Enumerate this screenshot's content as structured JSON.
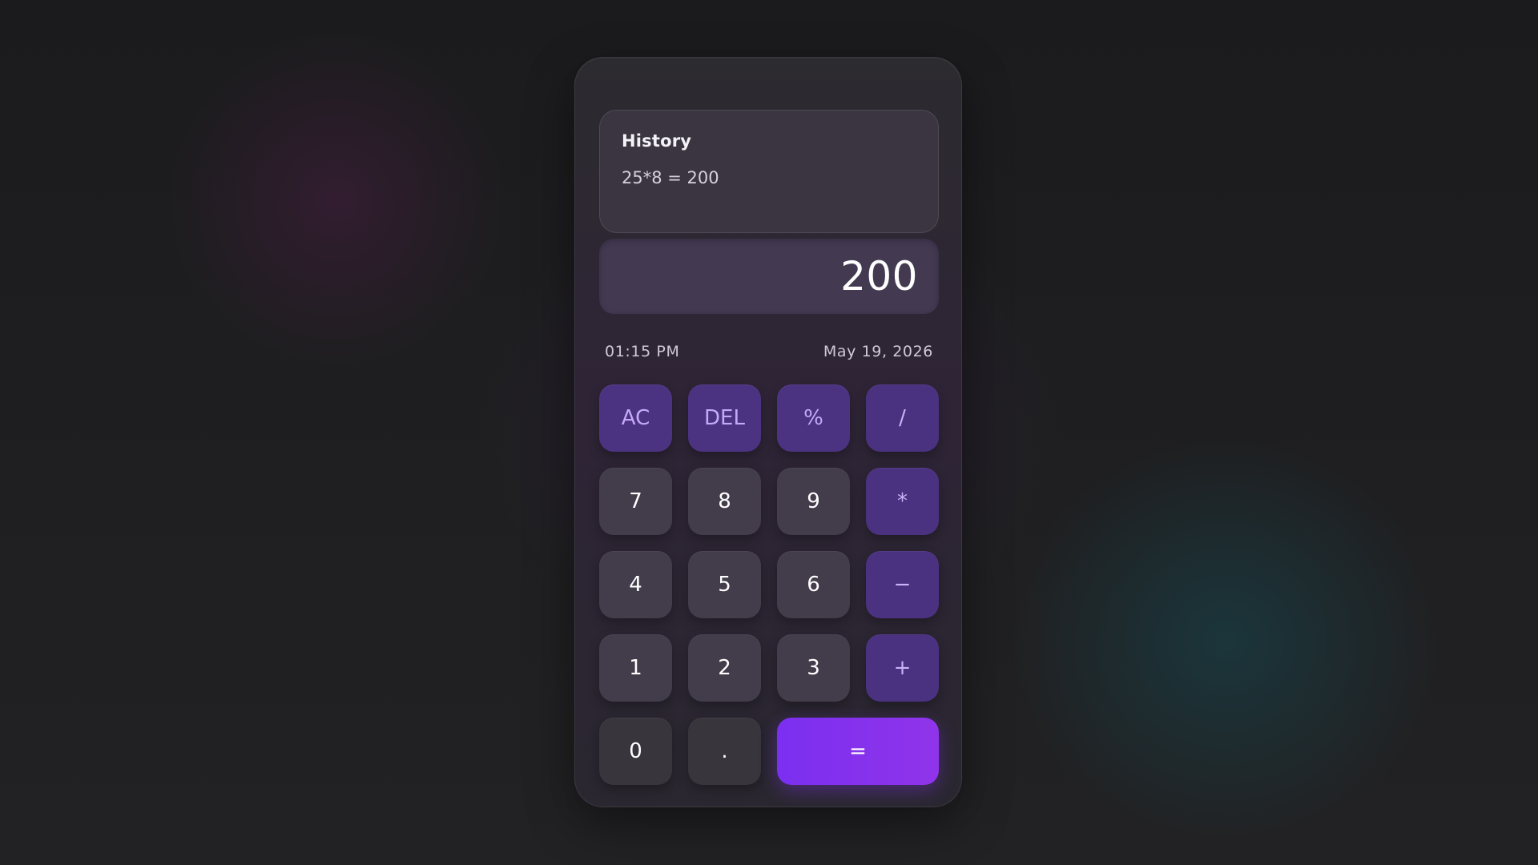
{
  "history": {
    "title": "History",
    "entries": [
      "25*8 = 200"
    ]
  },
  "display": {
    "value": "200"
  },
  "status": {
    "time": "01:15 PM",
    "date": "May 19, 2026"
  },
  "keys": {
    "ac": "AC",
    "del": "DEL",
    "percent": "%",
    "divide": "/",
    "seven": "7",
    "eight": "8",
    "nine": "9",
    "multiply": "*",
    "four": "4",
    "five": "5",
    "six": "6",
    "minus": "−",
    "one": "1",
    "two": "2",
    "three": "3",
    "plus": "+",
    "zero": "0",
    "decimal": ".",
    "equals": "="
  },
  "colors": {
    "accent": "#8a33ee",
    "function_key": "#4c3382",
    "number_key": "#433c4b",
    "display_bg": "#433a52"
  }
}
